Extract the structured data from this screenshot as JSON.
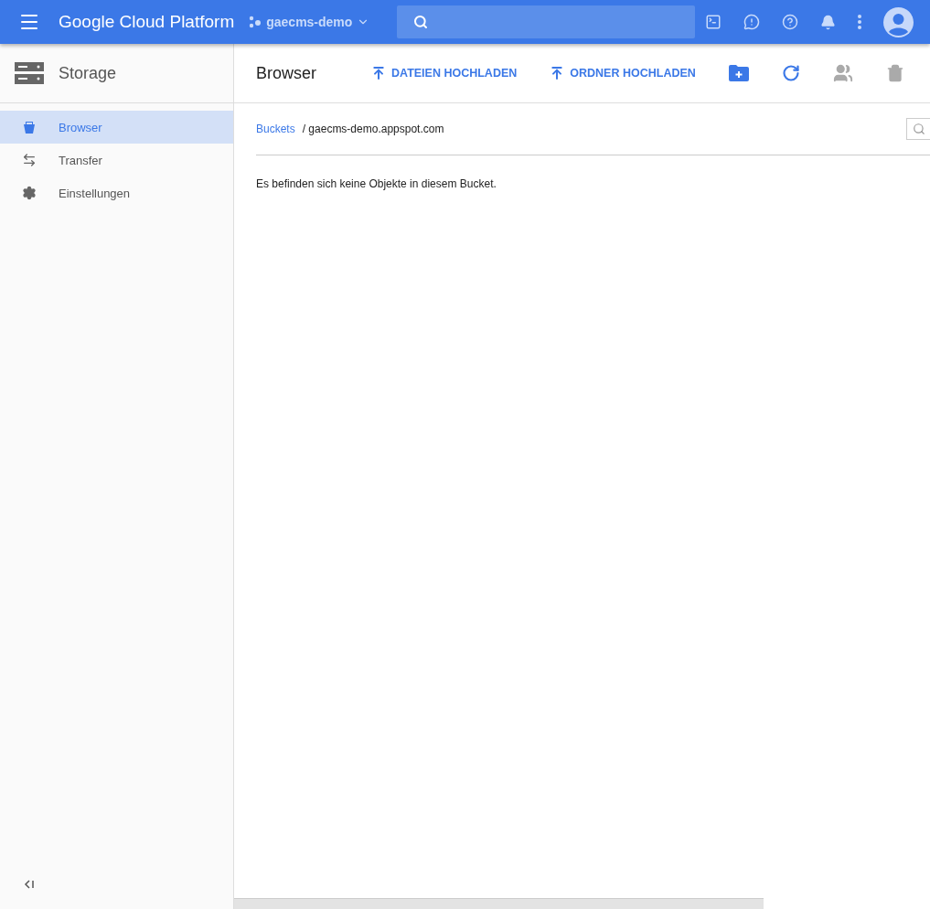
{
  "topbar": {
    "product": "Google Cloud Platform",
    "project": "gaecms-demo"
  },
  "sidebar": {
    "title": "Storage",
    "items": [
      {
        "label": "Browser",
        "kind": "bucket",
        "selected": true
      },
      {
        "label": "Transfer",
        "kind": "transfer",
        "selected": false
      },
      {
        "label": "Einstellungen",
        "kind": "settings",
        "selected": false
      }
    ]
  },
  "main": {
    "title": "Browser",
    "actions": [
      {
        "kind": "upload",
        "label": "DATEIEN HOCHLADEN",
        "disabled": false
      },
      {
        "kind": "upload",
        "label": "ORDNER HOCHLADEN",
        "disabled": false
      },
      {
        "kind": "folder",
        "disabled": false
      },
      {
        "kind": "refresh",
        "disabled": false
      },
      {
        "kind": "people",
        "disabled": true
      },
      {
        "kind": "trash",
        "disabled": true
      }
    ],
    "breadcrumb": {
      "link": "Buckets",
      "path": "/ gaecms-demo.appspot.com"
    },
    "message": "Es befinden sich keine Objekte in diesem Bucket."
  }
}
